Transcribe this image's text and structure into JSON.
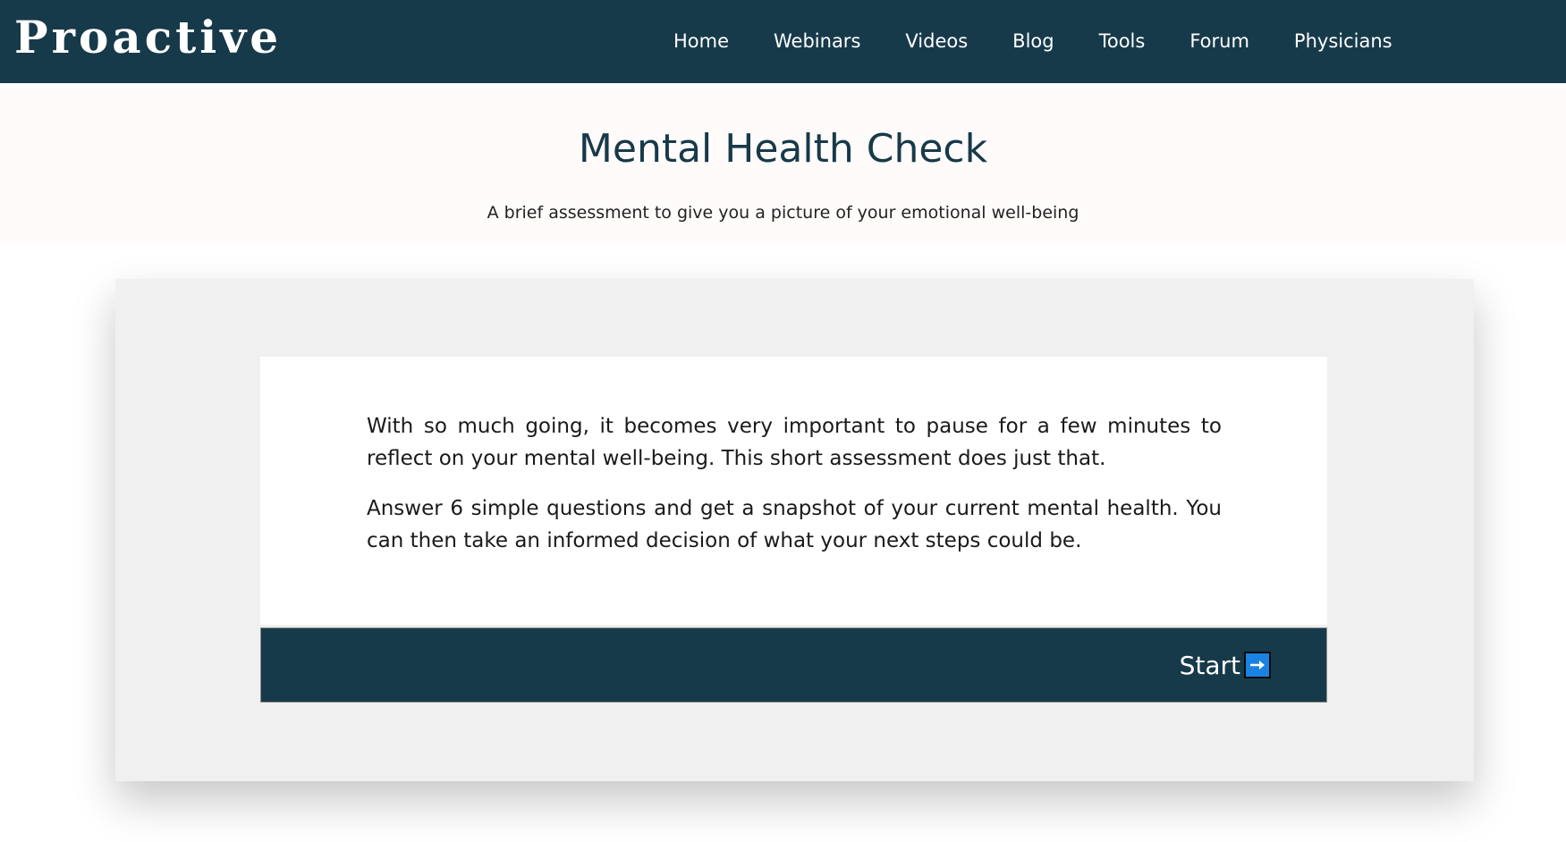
{
  "brand": {
    "logo_text": "Proactive"
  },
  "nav": {
    "items": [
      {
        "label": "Home"
      },
      {
        "label": "Webinars"
      },
      {
        "label": "Videos"
      },
      {
        "label": "Blog"
      },
      {
        "label": "Tools"
      },
      {
        "label": "Forum"
      },
      {
        "label": "Physicians"
      }
    ]
  },
  "hero": {
    "title": "Mental Health Check",
    "subtitle": "A brief assessment to give you a picture of your emotional well-being"
  },
  "intro": {
    "paragraphs": [
      "With so much going, it becomes very important to pause for a few minutes to reflect on your mental well-being. This short assessment does just that.",
      "Answer 6 simple questions and get a snapshot of your current mental health. You can then take an informed decision of what your next steps could be."
    ]
  },
  "start": {
    "label": "Start",
    "icon": "arrow-right-icon"
  },
  "colors": {
    "navbar": "#173a4a",
    "hero_background": "#fffbfa",
    "panel": "#f0f0f0",
    "accent": "#1a82e0"
  }
}
